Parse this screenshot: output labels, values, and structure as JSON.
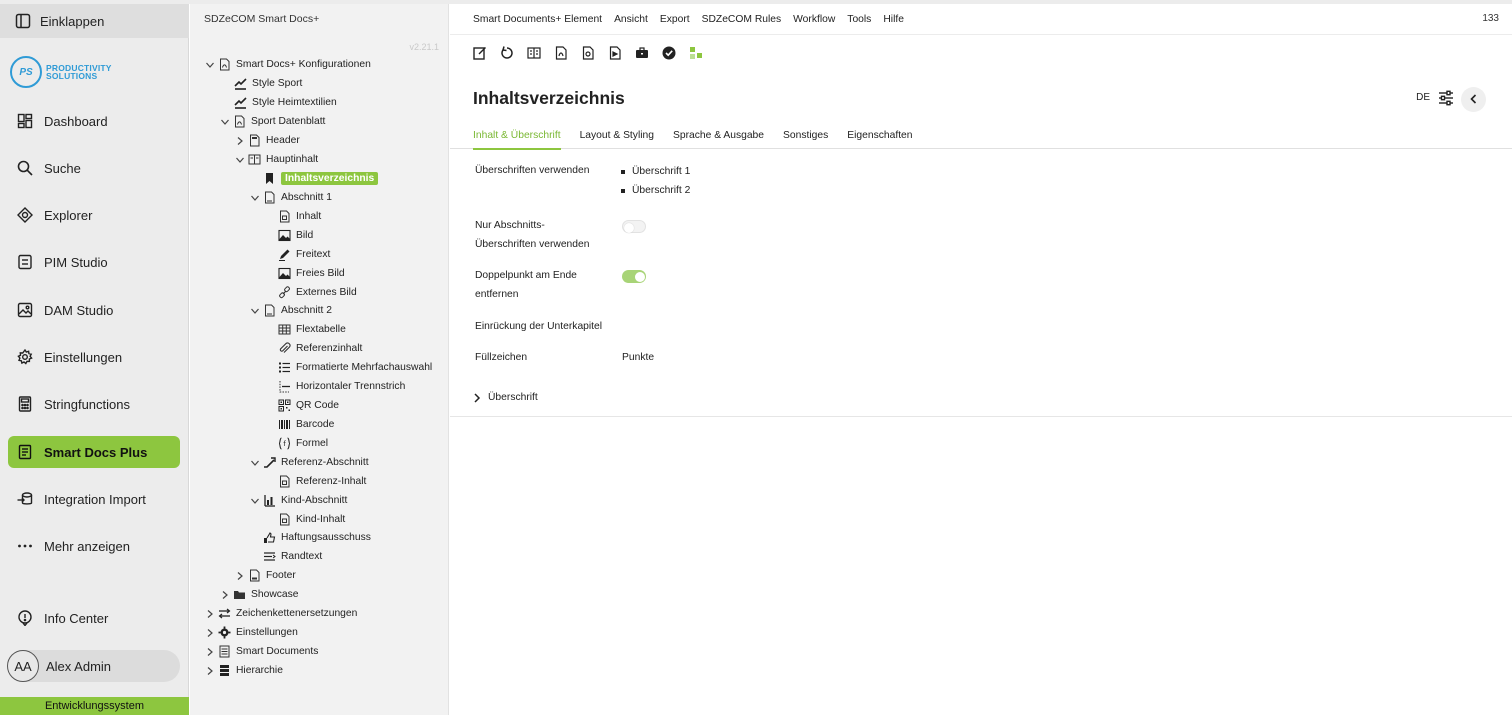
{
  "leftnav": {
    "collapse": "Einklappen",
    "logo": {
      "initials": "PS",
      "line1": "PRODUCTIVITY",
      "line2": "SOLUTIONS"
    },
    "items": [
      {
        "label": "Dashboard",
        "icon": "dashboard-icon"
      },
      {
        "label": "Suche",
        "icon": "search-icon"
      },
      {
        "label": "Explorer",
        "icon": "explorer-icon"
      },
      {
        "label": "PIM Studio",
        "icon": "pim-icon"
      },
      {
        "label": "DAM Studio",
        "icon": "image-icon"
      },
      {
        "label": "Einstellungen",
        "icon": "gear-icon"
      },
      {
        "label": "Stringfunctions",
        "icon": "calculator-icon"
      },
      {
        "label": "Smart Docs Plus",
        "icon": "document-icon"
      },
      {
        "label": "Integration Import",
        "icon": "import-icon"
      },
      {
        "label": "Mehr anzeigen",
        "icon": "more-icon"
      }
    ],
    "info": "Info Center",
    "user": {
      "initials": "AA",
      "name": "Alex Admin"
    },
    "env": "Entwicklungssystem"
  },
  "tree": {
    "title": "SDZeCOM Smart Docs+",
    "version": "v2.21.1",
    "nodes": [
      {
        "label": "Smart Docs+ Konfigurationen",
        "icon": "pdf-icon"
      },
      {
        "label": "Style Sport",
        "icon": "style-icon"
      },
      {
        "label": "Style Heimtextilien",
        "icon": "style-icon"
      },
      {
        "label": "Sport Datenblatt",
        "icon": "pdf-icon"
      },
      {
        "label": "Header",
        "icon": "header-icon"
      },
      {
        "label": "Hauptinhalt",
        "icon": "content-icon"
      },
      {
        "label": "Inhaltsverzeichnis",
        "icon": "bookmark-icon"
      },
      {
        "label": "Abschnitt 1",
        "icon": "section-icon"
      },
      {
        "label": "Inhalt",
        "icon": "content-file-icon"
      },
      {
        "label": "Bild",
        "icon": "picture-icon"
      },
      {
        "label": "Freitext",
        "icon": "pen-icon"
      },
      {
        "label": "Freies Bild",
        "icon": "picture-icon"
      },
      {
        "label": "Externes Bild",
        "icon": "link-icon"
      },
      {
        "label": "Abschnitt 2",
        "icon": "section-icon"
      },
      {
        "label": "Flextabelle",
        "icon": "table-icon"
      },
      {
        "label": "Referenzinhalt",
        "icon": "paperclip-icon"
      },
      {
        "label": "Formatierte Mehrfachauswahl",
        "icon": "list-icon"
      },
      {
        "label": "Horizontaler Trennstrich",
        "icon": "separator-icon"
      },
      {
        "label": "QR Code",
        "icon": "qr-code-icon"
      },
      {
        "label": "Barcode",
        "icon": "barcode-icon"
      },
      {
        "label": "Formel",
        "icon": "formula-icon"
      },
      {
        "label": "Referenz-Abschnitt",
        "icon": "reference-icon"
      },
      {
        "label": "Referenz-Inhalt",
        "icon": "content-file-icon"
      },
      {
        "label": "Kind-Abschnitt",
        "icon": "child-section-icon"
      },
      {
        "label": "Kind-Inhalt",
        "icon": "content-file-icon"
      },
      {
        "label": "Haftungsausschuss",
        "icon": "disclaimer-icon"
      },
      {
        "label": "Randtext",
        "icon": "margin-text-icon"
      },
      {
        "label": "Footer",
        "icon": "footer-icon"
      },
      {
        "label": "Showcase",
        "icon": "folder-icon"
      },
      {
        "label": "Zeichenkettenersetzungen",
        "icon": "swap-icon"
      },
      {
        "label": "Einstellungen",
        "icon": "gear-icon"
      },
      {
        "label": "Smart Documents",
        "icon": "document-icon"
      },
      {
        "label": "Hierarchie",
        "icon": "hierarchy-icon"
      }
    ]
  },
  "menubar": {
    "items": [
      "Smart Documents+ Element",
      "Ansicht",
      "Export",
      "SDZeCOM Rules",
      "Workflow",
      "Tools",
      "Hilfe"
    ],
    "count": "133"
  },
  "toolbar": [
    "edit-icon",
    "reload-icon",
    "compare-icon",
    "pdf-icon",
    "preview-icon",
    "export-icon",
    "briefcase-icon",
    "check-circle-icon",
    "structure-icon"
  ],
  "header": {
    "title": "Inhaltsverzeichnis",
    "lang": "DE"
  },
  "tabs": [
    "Inhalt & Überschrift",
    "Layout & Styling",
    "Sprache & Ausgabe",
    "Sonstiges",
    "Eigenschaften"
  ],
  "form": {
    "headings_label": "Überschriften verwenden",
    "headings_values": [
      "Überschrift 1",
      "Überschrift 2"
    ],
    "only_sections_label_1": "Nur Abschnitts-",
    "only_sections_label_2": "Überschriften verwenden",
    "only_sections_on": false,
    "colon_label_1": "Doppelpunkt am Ende",
    "colon_label_2": "entfernen",
    "colon_on": true,
    "indent_label": "Einrückung der Unterkapitel",
    "fill_label": "Füllzeichen",
    "fill_value": "Punkte",
    "section_heading": "Überschrift"
  },
  "colors": {
    "accent": "#8dc63f",
    "brand_blue": "#2f9bd6"
  }
}
